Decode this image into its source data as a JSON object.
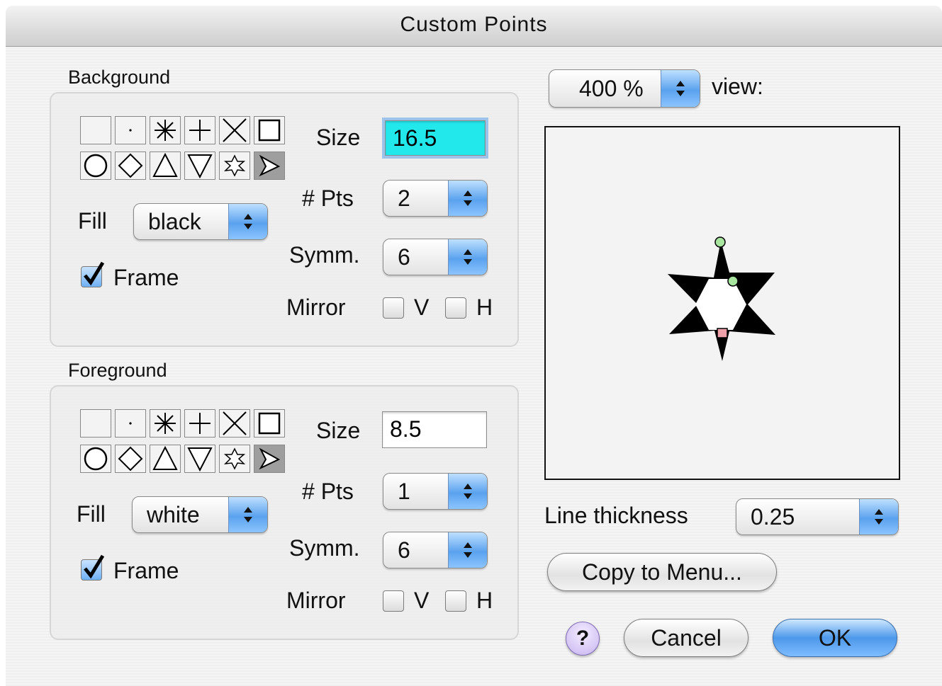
{
  "window": {
    "title": "Custom Points"
  },
  "background": {
    "label": "Background",
    "size_label": "Size",
    "size_value": "16.5",
    "pts_label": "# Pts",
    "pts_value": "2",
    "fill_label": "Fill",
    "fill_value": "black",
    "symm_label": "Symm.",
    "symm_value": "6",
    "frame_label": "Frame",
    "frame_checked": true,
    "mirror_label": "Mirror",
    "mirror_v_label": "V",
    "mirror_h_label": "H",
    "mirror_v_checked": false,
    "mirror_h_checked": false,
    "shape_icons": [
      "blank-icon",
      "dot-icon",
      "asterisk-icon",
      "plus-icon",
      "cross-icon",
      "square-icon",
      "circle-icon",
      "diamond-icon",
      "triangle-up-icon",
      "triangle-down-icon",
      "star-icon",
      "custom-point-icon"
    ],
    "selected_shape": "custom-point-icon"
  },
  "foreground": {
    "label": "Foreground",
    "size_label": "Size",
    "size_value": "8.5",
    "pts_label": "# Pts",
    "pts_value": "1",
    "fill_label": "Fill",
    "fill_value": "white",
    "symm_label": "Symm.",
    "symm_value": "6",
    "frame_label": "Frame",
    "frame_checked": true,
    "mirror_label": "Mirror",
    "mirror_v_label": "V",
    "mirror_h_label": "H",
    "mirror_v_checked": false,
    "mirror_h_checked": false,
    "shape_icons": [
      "blank-icon",
      "dot-icon",
      "asterisk-icon",
      "plus-icon",
      "cross-icon",
      "square-icon",
      "circle-icon",
      "diamond-icon",
      "triangle-up-icon",
      "triangle-down-icon",
      "star-icon",
      "custom-point-icon"
    ],
    "selected_shape": "custom-point-icon"
  },
  "view": {
    "zoom_value": "400 %",
    "label": "view:"
  },
  "line_thickness": {
    "label": "Line thickness",
    "value": "0.25"
  },
  "buttons": {
    "copy": "Copy to Menu...",
    "cancel": "Cancel",
    "ok": "OK",
    "help": "?"
  },
  "colors": {
    "focus_field": "#22e8ec",
    "default_button": "#4d98ea",
    "handle_green": "#a8e6a0",
    "handle_red": "#f0a0a8"
  }
}
